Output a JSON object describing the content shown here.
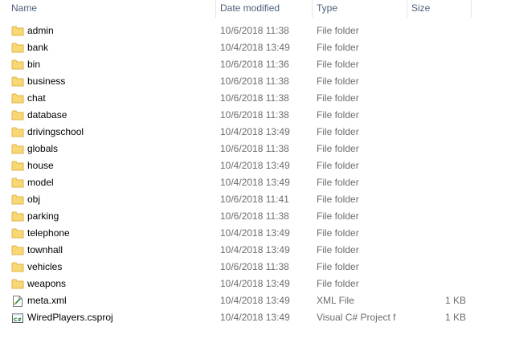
{
  "columns": {
    "name": "Name",
    "date_modified": "Date modified",
    "type": "Type",
    "size": "Size"
  },
  "files": [
    {
      "name": "admin",
      "date": "10/6/2018 11:38",
      "type": "File folder",
      "size": "",
      "icon": "folder-icon"
    },
    {
      "name": "bank",
      "date": "10/4/2018 13:49",
      "type": "File folder",
      "size": "",
      "icon": "folder-icon"
    },
    {
      "name": "bin",
      "date": "10/6/2018 11:36",
      "type": "File folder",
      "size": "",
      "icon": "folder-icon"
    },
    {
      "name": "business",
      "date": "10/6/2018 11:38",
      "type": "File folder",
      "size": "",
      "icon": "folder-icon"
    },
    {
      "name": "chat",
      "date": "10/6/2018 11:38",
      "type": "File folder",
      "size": "",
      "icon": "folder-icon"
    },
    {
      "name": "database",
      "date": "10/6/2018 11:38",
      "type": "File folder",
      "size": "",
      "icon": "folder-icon"
    },
    {
      "name": "drivingschool",
      "date": "10/4/2018 13:49",
      "type": "File folder",
      "size": "",
      "icon": "folder-icon"
    },
    {
      "name": "globals",
      "date": "10/6/2018 11:38",
      "type": "File folder",
      "size": "",
      "icon": "folder-icon"
    },
    {
      "name": "house",
      "date": "10/4/2018 13:49",
      "type": "File folder",
      "size": "",
      "icon": "folder-icon"
    },
    {
      "name": "model",
      "date": "10/4/2018 13:49",
      "type": "File folder",
      "size": "",
      "icon": "folder-icon"
    },
    {
      "name": "obj",
      "date": "10/6/2018 11:41",
      "type": "File folder",
      "size": "",
      "icon": "folder-icon"
    },
    {
      "name": "parking",
      "date": "10/6/2018 11:38",
      "type": "File folder",
      "size": "",
      "icon": "folder-icon"
    },
    {
      "name": "telephone",
      "date": "10/4/2018 13:49",
      "type": "File folder",
      "size": "",
      "icon": "folder-icon"
    },
    {
      "name": "townhall",
      "date": "10/4/2018 13:49",
      "type": "File folder",
      "size": "",
      "icon": "folder-icon"
    },
    {
      "name": "vehicles",
      "date": "10/6/2018 11:38",
      "type": "File folder",
      "size": "",
      "icon": "folder-icon"
    },
    {
      "name": "weapons",
      "date": "10/4/2018 13:49",
      "type": "File folder",
      "size": "",
      "icon": "folder-icon"
    },
    {
      "name": "meta.xml",
      "date": "10/4/2018 13:49",
      "type": "XML File",
      "size": "1 KB",
      "icon": "xml-file-icon"
    },
    {
      "name": "WiredPlayers.csproj",
      "date": "10/4/2018 13:49",
      "type": "Visual C# Project f",
      "size": "1 KB",
      "icon": "csproj-file-icon"
    }
  ],
  "colors": {
    "folder": "#f8d775",
    "folder_dark": "#e0b64a",
    "header_text": "#4c607a",
    "detail_text": "#6d6d6d"
  }
}
